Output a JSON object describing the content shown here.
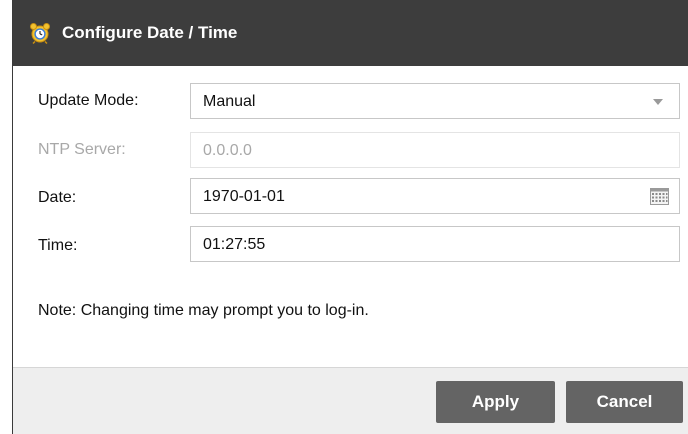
{
  "dialog": {
    "title": "Configure Date / Time",
    "title_icon": "alarm-clock-icon"
  },
  "form": {
    "update_mode": {
      "label": "Update Mode:",
      "value": "Manual"
    },
    "ntp_server": {
      "label": "NTP Server:",
      "value": "0.0.0.0",
      "disabled": true
    },
    "date": {
      "label": "Date:",
      "value": "1970-01-01",
      "icon": "calendar-icon"
    },
    "time": {
      "label": "Time:",
      "value": "01:27:55"
    }
  },
  "note": "Note: Changing time may prompt you to log-in.",
  "footer": {
    "apply_label": "Apply",
    "cancel_label": "Cancel"
  },
  "colors": {
    "titlebar": "#3d3d3d",
    "button": "#646464",
    "footer": "#eeeeee",
    "disabled_text": "#a8a8a8"
  }
}
